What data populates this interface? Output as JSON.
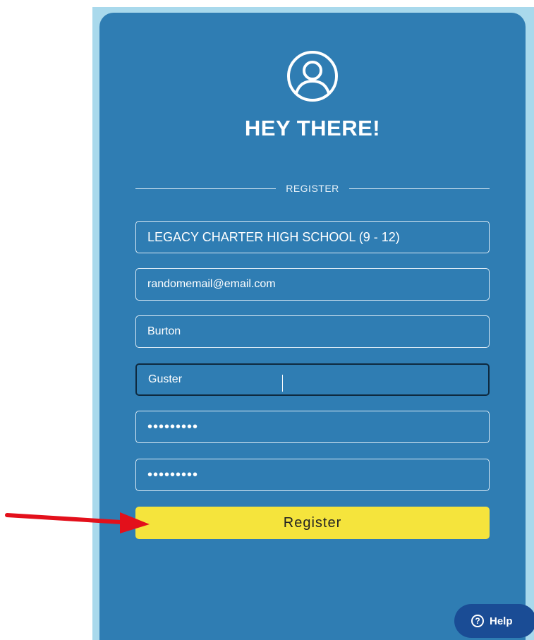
{
  "card": {
    "title": "HEY THERE!",
    "divider_label": "REGISTER"
  },
  "form": {
    "school": "LEGACY CHARTER HIGH SCHOOL (9 - 12)",
    "email": "randomemail@email.com",
    "first_name": "Burton",
    "last_name": "Guster",
    "password": "•••••••••",
    "confirm_password": "•••••••••",
    "submit_label": "Register"
  },
  "help": {
    "label": "Help",
    "icon_glyph": "?"
  },
  "icons": {
    "avatar": "user-circle-icon",
    "help": "question-circle-icon",
    "annotation": "red-arrow"
  },
  "colors": {
    "card_bg": "#2f7db3",
    "backdrop": "#a9d9ec",
    "button_bg": "#f5e43c",
    "help_bg": "#1a4c95",
    "arrow": "#e3101b"
  }
}
